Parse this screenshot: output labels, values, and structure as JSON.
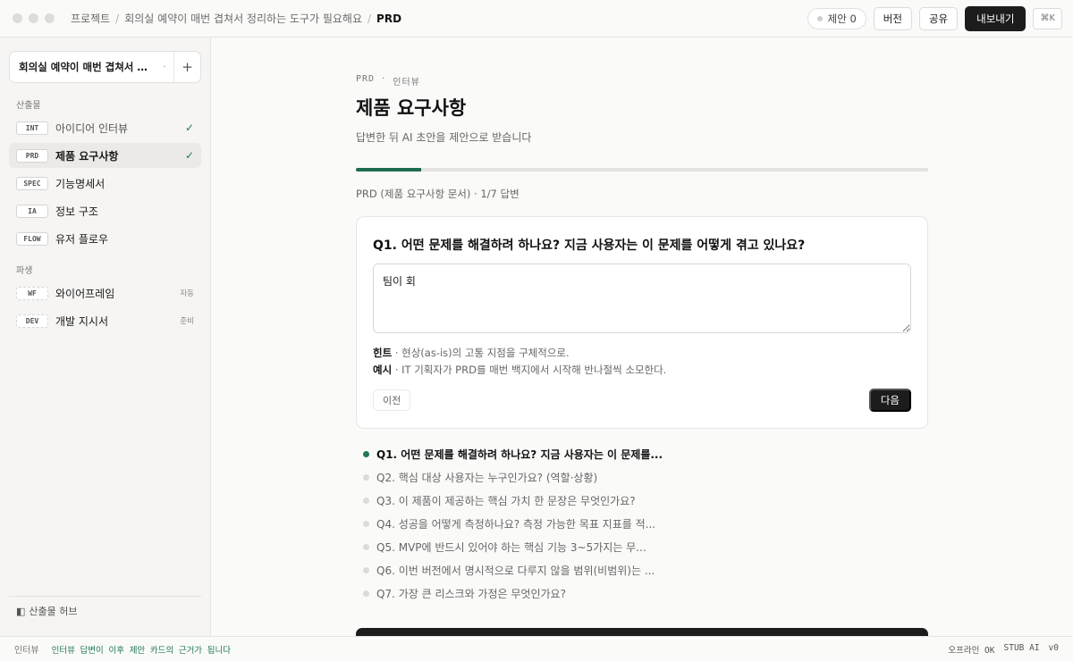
{
  "breadcrumb": {
    "root": "프로젝트",
    "project": "회의실 예약이 매번 겹쳐서 정리하는 도구가 필요해요",
    "current": "PRD"
  },
  "top_actions": {
    "suggestions": "제안 0",
    "version": "버전",
    "share": "공유",
    "export": "내보내기",
    "shortcut": "⌘K"
  },
  "sidebar": {
    "project_name": "회의실 예약이 매번 겹쳐서 정리하는 도구가 필요해요",
    "section_outputs": "산출물",
    "outputs": [
      {
        "tag": "INT",
        "label": "아이디어 인터뷰",
        "status": "✓"
      },
      {
        "tag": "PRD",
        "label": "제품 요구사항",
        "status": "✓"
      },
      {
        "tag": "SPEC",
        "label": "기능명세서",
        "status": ""
      },
      {
        "tag": "IA",
        "label": "정보 구조",
        "status": ""
      },
      {
        "tag": "FLOW",
        "label": "유저 플로우",
        "status": ""
      }
    ],
    "section_derived": "파생",
    "derived": [
      {
        "tag": "WF",
        "label": "와이어프레임",
        "status": "자동"
      },
      {
        "tag": "DEV",
        "label": "개발 지시서",
        "status": "준비"
      }
    ],
    "hub": "산출물 허브"
  },
  "main": {
    "eyebrow_code": "PRD",
    "eyebrow_dot": "·",
    "eyebrow_label": "인터뷰",
    "title": "제품 요구사항",
    "subtitle": "답변한 뒤 AI 초안을 제안으로 받습니다",
    "progress": 0.1143,
    "progress_label": "PRD (제품 요구사항 문서) · 1/7 답변",
    "question": "Q1. 어떤 문제를 해결하려 하나요? 지금 사용자는 이 문제를 어떻게 겪고 있나요?",
    "answer": "팀이 회",
    "hint_label": "힌트",
    "hint_text": " · 현상(as-is)의 고통 지점을 구체적으로.",
    "example_label": "예시",
    "example_text": " · IT 기획자가 PRD를 매번 백지에서 시작해 반나절씩 소모한다.",
    "prev": "이전",
    "next": "다음",
    "questions": [
      "Q1. 어떤 문제를 해결하려 하나요? 지금 사용자는 이 문제를...",
      "Q2. 핵심 대상 사용자는 누구인가요? (역할·상황)",
      "Q3. 이 제품이 제공하는 핵심 가치 한 문장은 무엇인가요?",
      "Q4. 성공을 어떻게 측정하나요? 측정 가능한 목표 지표를 적...",
      "Q5. MVP에 반드시 있어야 하는 핵심 기능 3~5가지는 무...",
      "Q6. 이번 버전에서 명시적으로 다루지 않을 범위(비범위)는 ...",
      "Q7. 가장 큰 리스크와 가정은 무엇인가요?"
    ]
  },
  "footer": {
    "left": "인터뷰",
    "message": "인터뷰 답변이 이후 제안 카드의 근거가 됩니다",
    "status_offline": "오프라인 OK",
    "status_ai": "STUB AI",
    "version": "v0"
  },
  "colors": {
    "accent": "#1f7a4f",
    "progress_fill": "#1f6b4e",
    "dark_button": "#1c1c1c"
  }
}
